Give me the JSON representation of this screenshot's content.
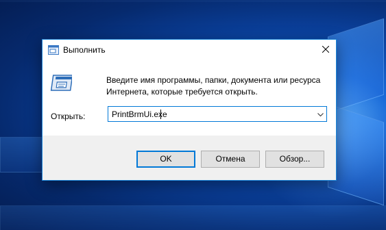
{
  "dialog": {
    "title": "Выполнить",
    "description_line1": "Введите имя программы, папки, документа или ресурса",
    "description_line2": "Интернета, которые требуется открыть.",
    "open_label": "Открыть:",
    "open_value": "PrintBrmUi.exe",
    "buttons": {
      "ok": "OK",
      "cancel": "Отмена",
      "browse": "Обзор..."
    }
  },
  "colors": {
    "accent": "#0078d7",
    "footer_bg": "#f0f0f0",
    "button_bg": "#e1e1e1",
    "desktop_blue": "#0a3f9a"
  },
  "icons": {
    "title": "run-icon",
    "content": "run-icon",
    "close": "close-icon",
    "dropdown": "chevron-down-icon"
  }
}
